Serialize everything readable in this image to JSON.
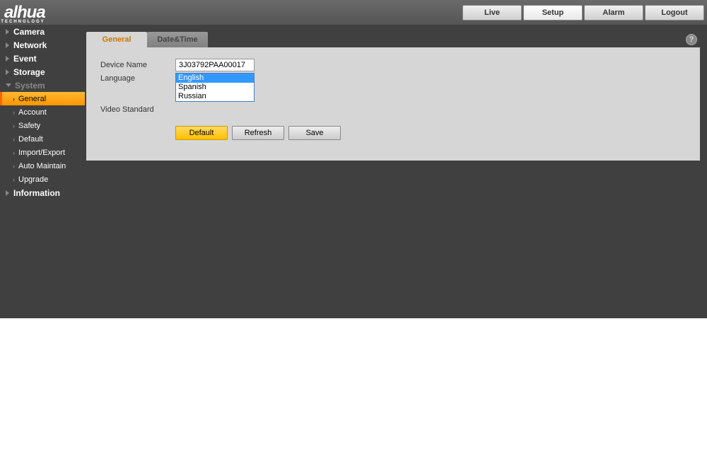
{
  "brand": {
    "name": "alhua",
    "sub": "TECHNOLOGY"
  },
  "topnav": {
    "live": "Live",
    "setup": "Setup",
    "alarm": "Alarm",
    "logout": "Logout"
  },
  "sidebar": {
    "camera": "Camera",
    "network": "Network",
    "event": "Event",
    "storage": "Storage",
    "system": "System",
    "system_sub": {
      "general": "General",
      "account": "Account",
      "safety": "Safety",
      "default": "Default",
      "import_export": "Import/Export",
      "auto_maintain": "Auto Maintain",
      "upgrade": "Upgrade"
    },
    "information": "Information"
  },
  "tabs": {
    "general": "General",
    "datetime": "Date&Time"
  },
  "form": {
    "device_name_label": "Device Name",
    "device_name_value": "3J03792PAA00017",
    "language_label": "Language",
    "language_options": [
      "English",
      "Spanish",
      "Russian"
    ],
    "video_standard_label": "Video Standard"
  },
  "buttons": {
    "default": "Default",
    "refresh": "Refresh",
    "save": "Save"
  },
  "help": "?"
}
